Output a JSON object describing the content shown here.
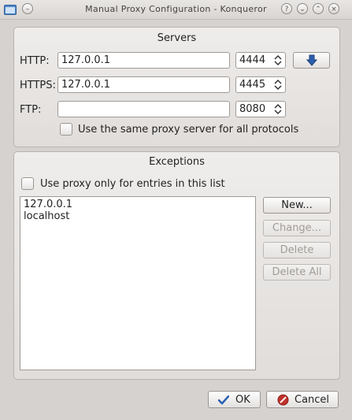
{
  "window": {
    "title": "Manual Proxy Configuration - Konqueror"
  },
  "servers": {
    "heading": "Servers",
    "http": {
      "label": "HTTP:",
      "value": "127.0.0.1",
      "port": "4444"
    },
    "https": {
      "label": "HTTPS:",
      "value": "127.0.0.1",
      "port": "4445"
    },
    "ftp": {
      "label": "FTP:",
      "value": "",
      "port": "8080"
    },
    "same_proxy_label": "Use the same proxy server for all protocols",
    "copy_down_icon": "arrow-down-icon"
  },
  "exceptions": {
    "heading": "Exceptions",
    "only_label": "Use proxy only for entries in this list",
    "entries": [
      "127.0.0.1",
      "localhost"
    ],
    "new_label": "New...",
    "change_label": "Change...",
    "delete_label": "Delete",
    "delete_all_label": "Delete All"
  },
  "footer": {
    "ok_label": "OK",
    "cancel_label": "Cancel"
  },
  "colors": {
    "accent": "#2b5fae",
    "cancel_red": "#c0302a"
  }
}
